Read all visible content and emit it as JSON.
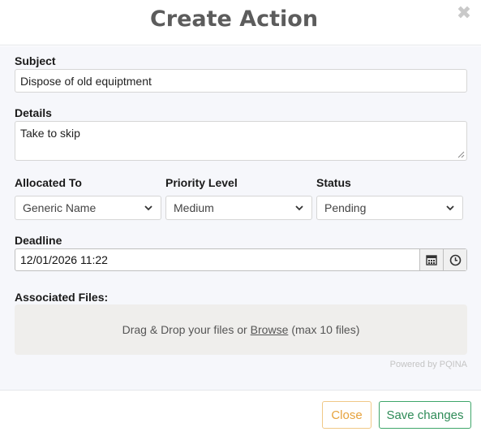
{
  "modal": {
    "title": "Create Action",
    "close_icon": "close-icon"
  },
  "form": {
    "subject": {
      "label": "Subject",
      "value": "Dispose of old equiptment"
    },
    "details": {
      "label": "Details",
      "value": "Take to skip"
    },
    "allocated_to": {
      "label": "Allocated To",
      "value": "Generic Name"
    },
    "priority_level": {
      "label": "Priority Level",
      "value": "Medium"
    },
    "status": {
      "label": "Status",
      "value": "Pending"
    },
    "deadline": {
      "label": "Deadline",
      "value": "12/01/2026 11:22",
      "calendar_icon": "calendar-icon",
      "clock_icon": "clock-icon"
    },
    "files": {
      "label": "Associated Files:",
      "drop_prefix": "Drag & Drop your files or",
      "browse_label": "Browse",
      "drop_suffix": "(max 10 files)",
      "powered_by": "Powered by PQINA"
    }
  },
  "footer": {
    "close_label": "Close",
    "save_label": "Save changes"
  },
  "colors": {
    "title": "#5c5c5c",
    "close_button": "#e6a23c",
    "save_button": "#2e8b57",
    "dropzone_bg": "#efeeec"
  }
}
